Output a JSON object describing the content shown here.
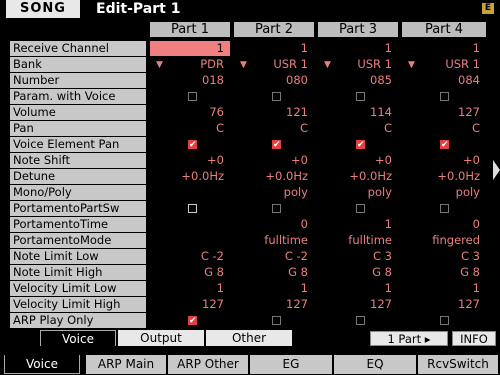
{
  "header": {
    "mode": "SONG",
    "title": "Edit-Part 1",
    "icon": "E"
  },
  "columns": [
    "Part 1",
    "Part 2",
    "Part 3",
    "Part 4"
  ],
  "rows": [
    {
      "label": "Receive Channel",
      "values": [
        "1",
        "1",
        "1",
        "1"
      ]
    },
    {
      "label": "Bank",
      "values": [
        "PDR",
        "USR 1",
        "USR 1",
        "USR 1"
      ]
    },
    {
      "label": "Number",
      "values": [
        "018",
        "080",
        "085",
        "084"
      ]
    },
    {
      "label": "Param. with Voice",
      "values": [
        "",
        "",
        "",
        ""
      ]
    },
    {
      "label": "Volume",
      "values": [
        "76",
        "121",
        "114",
        "127"
      ]
    },
    {
      "label": "Pan",
      "values": [
        "C",
        "C",
        "C",
        "C"
      ]
    },
    {
      "label": "Voice Element Pan",
      "values": [
        "",
        "",
        "",
        ""
      ]
    },
    {
      "label": "Note Shift",
      "values": [
        "+0",
        "+0",
        "+0",
        "+0"
      ]
    },
    {
      "label": "Detune",
      "values": [
        "+0.0Hz",
        "+0.0Hz",
        "+0.0Hz",
        "+0.0Hz"
      ]
    },
    {
      "label": "Mono/Poly",
      "values": [
        "",
        "poly",
        "poly",
        "poly"
      ]
    },
    {
      "label": "PortamentoPartSw",
      "values": [
        "",
        "",
        "",
        ""
      ]
    },
    {
      "label": "PortamentoTime",
      "values": [
        "",
        "0",
        "1",
        "0"
      ]
    },
    {
      "label": "PortamentoMode",
      "values": [
        "",
        "fulltime",
        "fulltime",
        "fingered"
      ]
    },
    {
      "label": "Note Limit Low",
      "values": [
        "C -2",
        "C -2",
        "C 3",
        "C 3"
      ]
    },
    {
      "label": "Note Limit High",
      "values": [
        "G 8",
        "G 8",
        "G 8",
        "G 8"
      ]
    },
    {
      "label": "Velocity Limit Low",
      "values": [
        "1",
        "1",
        "1",
        "1"
      ]
    },
    {
      "label": "Velocity Limit High",
      "values": [
        "127",
        "127",
        "127",
        "127"
      ]
    },
    {
      "label": "ARP Play Only",
      "values": [
        "",
        "",
        "",
        ""
      ]
    }
  ],
  "checkmark": "✔",
  "subtabs": {
    "voice": "Voice",
    "output": "Output",
    "other": "Other"
  },
  "part_button": "1 Part ▸",
  "info_button": "INFO",
  "tabs": [
    "Voice",
    "ARP Main",
    "ARP Other",
    "EG",
    "EQ",
    "RcvSwitch"
  ]
}
